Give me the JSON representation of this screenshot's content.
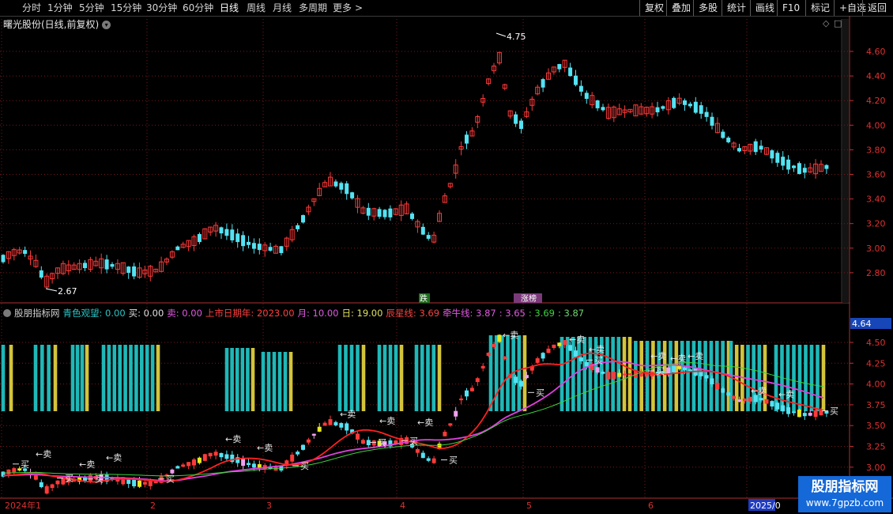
{
  "toolbar": {
    "periods": [
      "分时",
      "1分钟",
      "5分钟",
      "15分钟",
      "30分钟",
      "60分钟",
      "日线",
      "周线",
      "月线",
      "多周期",
      "更多"
    ],
    "active": "日线",
    "right_buttons": [
      "复权",
      "叠加",
      "多股",
      "统计",
      "画线",
      "F10",
      "标记",
      "+自选",
      "返回"
    ]
  },
  "main": {
    "title": "曙光股份(日线,前复权)",
    "high_label": "4.75",
    "low_label": "2.67",
    "event_down": "跌",
    "event_up": "",
    "event_rank": "涨榜",
    "price_axis": [
      "4.60",
      "4.40",
      "4.20",
      "4.00",
      "3.80",
      "3.60",
      "3.40",
      "3.20",
      "3.00",
      "2.80"
    ]
  },
  "indicator": {
    "name": "股朋指标网",
    "fields": [
      {
        "label": "青色观望: ",
        "value": "0.00",
        "color": "#29c4c4"
      },
      {
        "label": "买: ",
        "value": "0.00",
        "color": "#e0e0e0"
      },
      {
        "label": "卖: ",
        "value": "0.00",
        "color": "#e05ae0"
      },
      {
        "label": "上市日期年: ",
        "value": "2023.00",
        "color": "#ff4040"
      },
      {
        "label": "月: ",
        "value": "10.00",
        "color": "#e05ae0"
      },
      {
        "label": "日: ",
        "value": "19.00",
        "color": "#e0e060"
      },
      {
        "label": "辰星线: ",
        "value": "3.69",
        "color": "#ff4040"
      },
      {
        "label": "牵牛线: ",
        "value": "3.87",
        "color": "#e05ae0"
      },
      {
        "label": ": ",
        "value": "3.65",
        "color": "#e05ae0"
      },
      {
        "label": ": ",
        "value": "3.69",
        "color": "#39d43a"
      },
      {
        "label": ": ",
        "value": "3.87",
        "color": "#6fd66f"
      }
    ],
    "price_axis": [
      "4.50",
      "4.25",
      "4.00",
      "3.75",
      "3.50",
      "3.25",
      "3.00"
    ],
    "current_price": "4.64",
    "buy_label": "买",
    "sell_label": "←卖"
  },
  "time_axis": [
    "2024年1",
    "2",
    "3",
    "4",
    "5",
    "6",
    "2025/0"
  ],
  "watermark": {
    "title": "股朋指标网",
    "url": "www.7gpzb.com"
  },
  "colors": {
    "up": "#ff3a3a",
    "down": "#54e3f3",
    "cyan_bar": "#1fb8b8",
    "yellow_bar": "#d3c43a",
    "magenta_line": "#e040e0",
    "red_line": "#ff2020",
    "green_line": "#3ad43a"
  },
  "icons": {
    "title_menu": "chevron-down-icon",
    "more": "chevron-right-icon",
    "panel_pin": "diamond-icon"
  }
}
